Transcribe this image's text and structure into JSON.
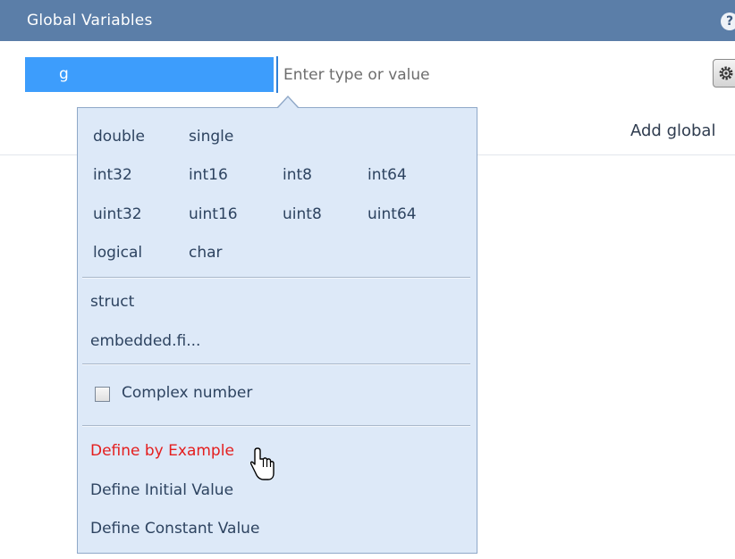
{
  "header": {
    "title": "Global Variables",
    "help_icon": "help-icon",
    "help_symbol": "?"
  },
  "variable_row": {
    "name": "g",
    "value_placeholder": "Enter type or value",
    "value": "",
    "settings_icon": "gear-icon"
  },
  "add_global_label": "Add global",
  "type_menu": {
    "numeric_types": [
      [
        "double",
        "single"
      ],
      [
        "int32",
        "int16",
        "int8",
        "int64"
      ],
      [
        "uint32",
        "uint16",
        "uint8",
        "uint64"
      ],
      [
        "logical",
        "char"
      ]
    ],
    "other_types": [
      "struct",
      "embedded.fi..."
    ],
    "complex_number": {
      "label": "Complex number",
      "checked": false
    },
    "define_options": [
      {
        "label": "Define by Example",
        "highlighted": true
      },
      {
        "label": "Define Initial Value",
        "highlighted": false
      },
      {
        "label": "Define Constant Value",
        "highlighted": false
      }
    ]
  },
  "colors": {
    "header_bg": "#5b7ea8",
    "selected_name_bg": "#3d9dfc",
    "popup_bg": "#dde9f8",
    "highlight_text": "#e41e1e"
  }
}
